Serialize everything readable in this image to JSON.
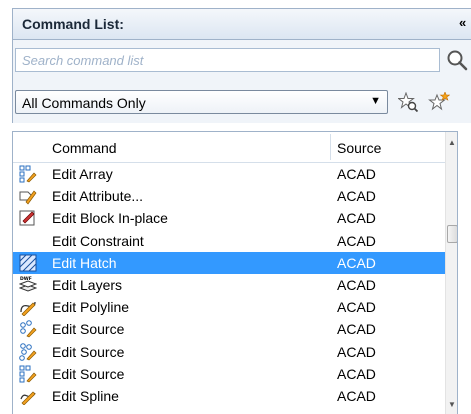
{
  "panel": {
    "title": "Command List:"
  },
  "search": {
    "placeholder": "Search command list",
    "value": ""
  },
  "filter": {
    "selected": "All Commands Only"
  },
  "columns": {
    "command": "Command",
    "source": "Source"
  },
  "rows": [
    {
      "command": "Edit Array",
      "source": "ACAD",
      "icon": "array-edit-icon"
    },
    {
      "command": "Edit Attribute...",
      "source": "ACAD",
      "icon": "attribute-edit-icon"
    },
    {
      "command": "Edit Block In-place",
      "source": "ACAD",
      "icon": "block-edit-icon"
    },
    {
      "command": "Edit Constraint",
      "source": "ACAD",
      "icon": ""
    },
    {
      "command": "Edit Hatch",
      "source": "ACAD",
      "icon": "hatch-edit-icon"
    },
    {
      "command": "Edit Layers",
      "source": "ACAD",
      "icon": "layers-edit-icon"
    },
    {
      "command": "Edit Polyline",
      "source": "ACAD",
      "icon": "polyline-edit-icon"
    },
    {
      "command": "Edit Source",
      "source": "ACAD",
      "icon": "source-edit-icon"
    },
    {
      "command": "Edit Source",
      "source": "ACAD",
      "icon": "source-edit-icon"
    },
    {
      "command": "Edit Source",
      "source": "ACAD",
      "icon": "source-edit-icon"
    },
    {
      "command": "Edit Spline",
      "source": "ACAD",
      "icon": "spline-edit-icon"
    }
  ],
  "selected_row": 4,
  "colors": {
    "selection": "#3399ff",
    "header_border": "#9fb2c9"
  }
}
